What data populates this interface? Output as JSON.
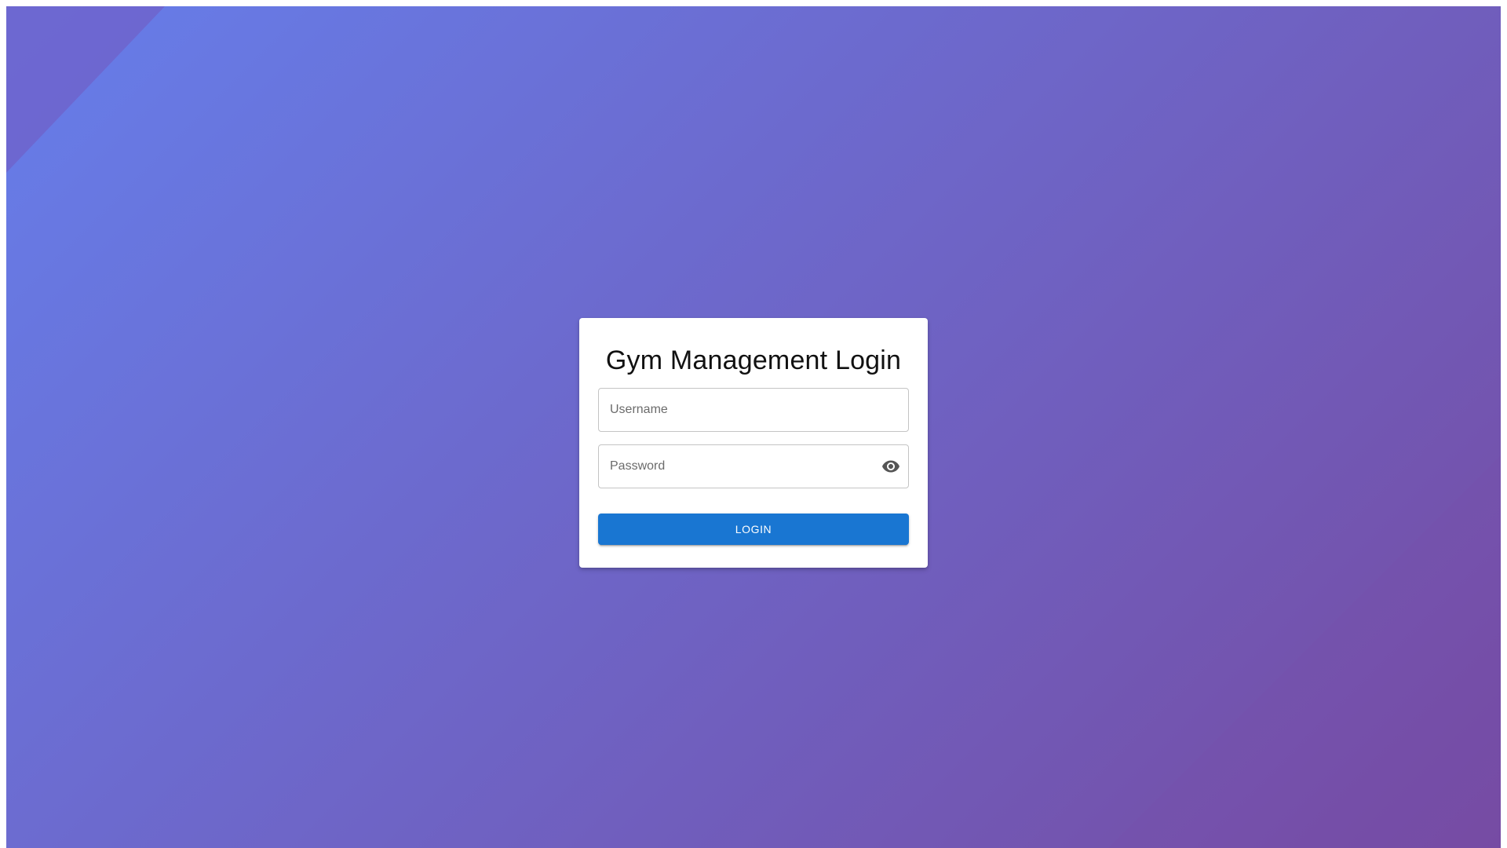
{
  "login": {
    "title": "Gym Management Login",
    "username_placeholder": "Username",
    "username_value": "",
    "password_placeholder": "Password",
    "password_value": "",
    "password_toggle_icon": "eye-icon",
    "submit_label": "LOGIN"
  },
  "colors": {
    "background_gradient_start": "#667eea",
    "background_gradient_end": "#764ba2",
    "button": "#1976d2",
    "card": "#ffffff"
  }
}
